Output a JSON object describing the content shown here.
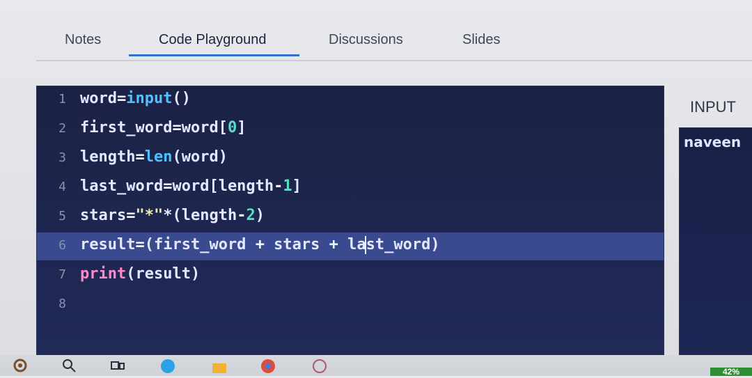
{
  "tabs": [
    {
      "label": "Notes",
      "active": false
    },
    {
      "label": "Code Playground",
      "active": true
    },
    {
      "label": "Discussions",
      "active": false
    },
    {
      "label": "Slides",
      "active": false
    }
  ],
  "editor": {
    "current_line": 6,
    "lines": [
      {
        "n": "1",
        "code": "word=input()"
      },
      {
        "n": "2",
        "code": "first_word=word[0]"
      },
      {
        "n": "3",
        "code": "length=len(word)"
      },
      {
        "n": "4",
        "code": "last_word=word[length-1]"
      },
      {
        "n": "5",
        "code": "stars=\"*\"*(length-2)"
      },
      {
        "n": "6",
        "code": "result=(first_word + stars + last_word)"
      },
      {
        "n": "7",
        "code": "print(result)"
      },
      {
        "n": "8",
        "code": ""
      }
    ]
  },
  "input_panel": {
    "label": "INPUT",
    "value": "naveen"
  },
  "taskbar": {
    "icons": [
      "settings-icon",
      "search-icon",
      "task-view-icon",
      "edge-browser-icon",
      "file-explorer-icon",
      "chrome-icon",
      "app-icon"
    ],
    "battery_text": "42%"
  },
  "colors": {
    "editor_bg": "#1b2244",
    "current_line_bg": "#3a4a8e",
    "keyword": "#4ec2ff",
    "function": "#ff89c8",
    "number": "#54e0c4",
    "tab_accent": "#2f6fd6"
  }
}
